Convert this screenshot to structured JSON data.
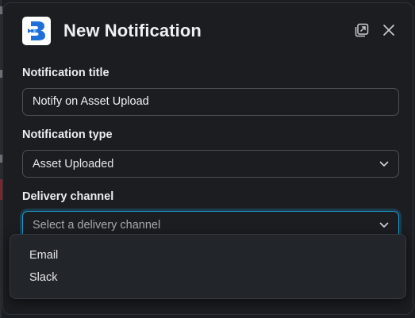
{
  "dialog": {
    "title": "New Notification",
    "logo_icon": "app-logo-b",
    "popout_icon": "popout-icon",
    "close_icon": "close-icon"
  },
  "fields": {
    "notification_title": {
      "label": "Notification title",
      "value": "Notify on Asset Upload"
    },
    "notification_type": {
      "label": "Notification type",
      "selected": "Asset Uploaded"
    },
    "delivery_channel": {
      "label": "Delivery channel",
      "placeholder": "Select a delivery channel",
      "options": [
        "Email",
        "Slack"
      ]
    }
  },
  "colors": {
    "background": "#1b1d21",
    "focus_accent": "#1d9bd1",
    "logo_blue": "#1e6fd9"
  }
}
